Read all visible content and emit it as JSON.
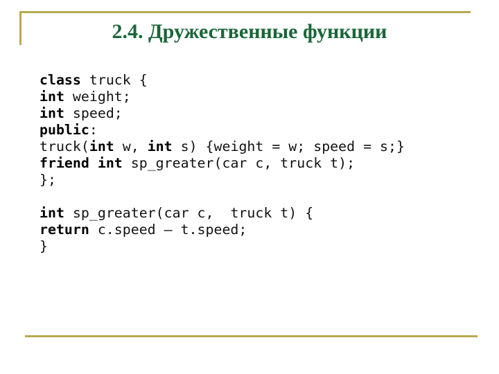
{
  "slide": {
    "title": "2.4. Дружественные функции",
    "colors": {
      "title": "#1a6638",
      "rules": "#b8a850",
      "code": "#111111",
      "background": "#ffffff"
    }
  },
  "code": {
    "lines": [
      [
        {
          "t": "class",
          "kw": true
        },
        {
          "t": " truck {",
          "kw": false
        }
      ],
      [
        {
          "t": "int",
          "kw": true
        },
        {
          "t": " weight;",
          "kw": false
        }
      ],
      [
        {
          "t": "int",
          "kw": true
        },
        {
          "t": " speed;",
          "kw": false
        }
      ],
      [
        {
          "t": "public",
          "kw": true
        },
        {
          "t": ":",
          "kw": false
        }
      ],
      [
        {
          "t": "truck(",
          "kw": false
        },
        {
          "t": "int",
          "kw": true
        },
        {
          "t": " w, ",
          "kw": false
        },
        {
          "t": "int",
          "kw": true
        },
        {
          "t": " s) {weight = w; speed = s;}",
          "kw": false
        }
      ],
      [
        {
          "t": "friend",
          "kw": true
        },
        {
          "t": " ",
          "kw": false
        },
        {
          "t": "int",
          "kw": true
        },
        {
          "t": " sp_greater(car c, truck t);",
          "kw": false
        }
      ],
      [
        {
          "t": "};",
          "kw": false
        }
      ],
      [
        {
          "t": "",
          "kw": false
        }
      ],
      [
        {
          "t": "int",
          "kw": true
        },
        {
          "t": " sp_greater(car c,  truck t) {",
          "kw": false
        }
      ],
      [
        {
          "t": "return",
          "kw": true
        },
        {
          "t": " c.speed – t.speed;",
          "kw": false
        }
      ],
      [
        {
          "t": "}",
          "kw": false
        }
      ]
    ]
  }
}
